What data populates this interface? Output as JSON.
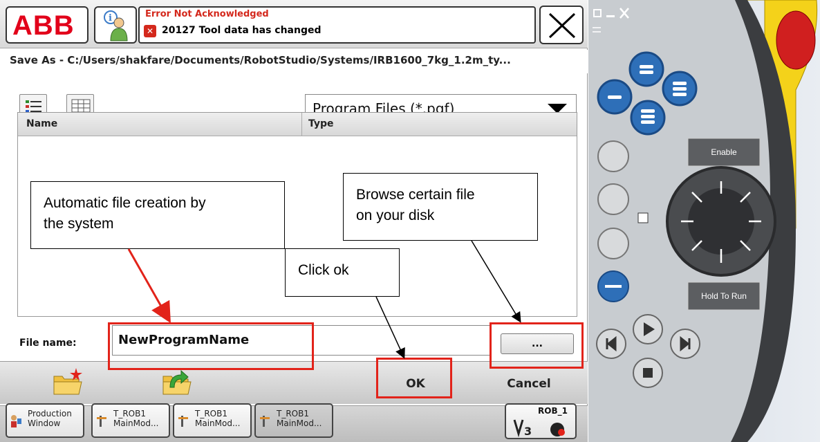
{
  "topbar": {
    "logo_text": "ABB",
    "event": {
      "title": "Error Not Acknowledged",
      "error_icon": "error-x-icon",
      "message": "20127 Tool data has changed"
    }
  },
  "dialog": {
    "path": "Save As  -  C:/Users/shakfare/Documents/RobotStudio/Systems/IRB1600_7kg_1.2m_ty...",
    "filter": "Program Files (*.pgf)",
    "columns": [
      "Name",
      "Type"
    ],
    "filename_label": "File name:",
    "filename_value": "NewProgramName",
    "browse_label": "...",
    "ok_label": "OK",
    "cancel_label": "Cancel"
  },
  "taskbar": {
    "items": [
      {
        "line1": "Production",
        "line2": "Window"
      },
      {
        "line1": "T_ROB1",
        "line2": "MainMod..."
      },
      {
        "line1": "T_ROB1",
        "line2": "MainMod..."
      },
      {
        "line1": "T_ROB1",
        "line2": "MainMod..."
      }
    ],
    "robot": "ROB_1"
  },
  "annotations": {
    "auto_create": {
      "line1": "Automatic file creation by",
      "line2": "the system"
    },
    "browse": {
      "line1": "Browse certain file",
      "line2": "on your disk"
    },
    "click_ok": "Click ok"
  },
  "device": {
    "enable": "Enable",
    "hold_to_run": "Hold To Run"
  },
  "colors": {
    "abb_red": "#e2001a",
    "annotation_red": "#e2231a",
    "joystick_blue": "#2e6fb8"
  }
}
